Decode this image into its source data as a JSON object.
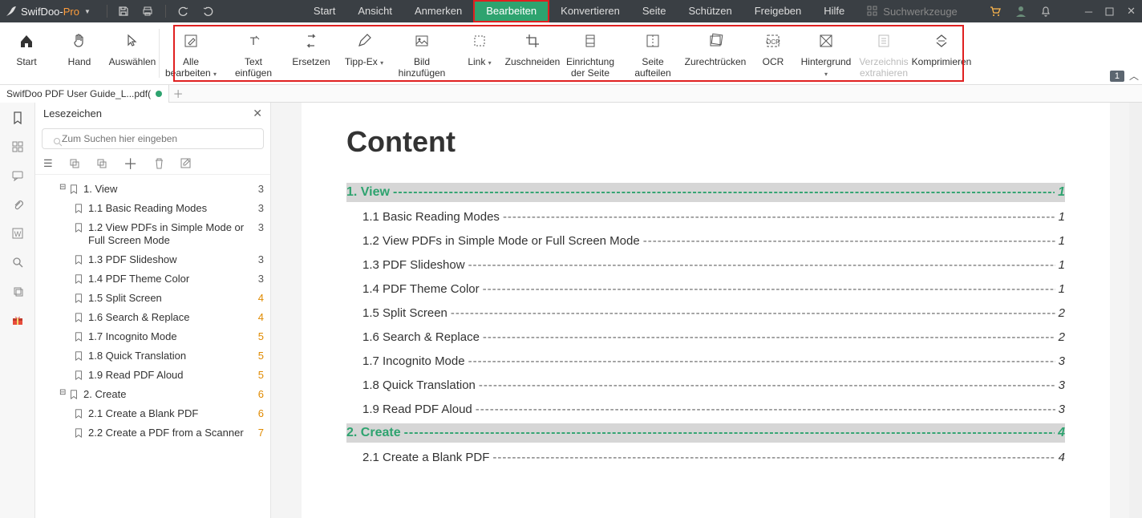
{
  "app": {
    "name1": "SwifDoo-",
    "name2": "Pro"
  },
  "menu": {
    "items": [
      "Start",
      "Ansicht",
      "Anmerken",
      "Bearbeiten",
      "Konvertieren",
      "Seite",
      "Schützen",
      "Freigeben",
      "Hilfe"
    ],
    "active_index": 3,
    "search_placeholder": "Suchwerkzeuge"
  },
  "ribbon": {
    "left": [
      {
        "label": "Start",
        "icon": "home"
      },
      {
        "label": "Hand",
        "icon": "hand"
      },
      {
        "label": "Auswählen",
        "icon": "pointer"
      }
    ],
    "tools": [
      {
        "label": "Alle bearbeiten",
        "icon": "edit-all",
        "drop": true
      },
      {
        "label": "Text einfügen",
        "icon": "text"
      },
      {
        "label": "Ersetzen",
        "icon": "replace"
      },
      {
        "label": "Tipp-Ex",
        "icon": "pen",
        "drop": true
      },
      {
        "label": "Bild hinzufügen",
        "icon": "image"
      },
      {
        "label": "Link",
        "icon": "link",
        "drop": true
      },
      {
        "label": "Zuschneiden",
        "icon": "crop"
      },
      {
        "label": "Einrichtung der Seite",
        "icon": "page-setup"
      },
      {
        "label": "Seite aufteilen",
        "icon": "split"
      },
      {
        "label": "Zurechtrücken",
        "icon": "deskew"
      },
      {
        "label": "OCR",
        "icon": "ocr"
      },
      {
        "label": "Hintergrund",
        "icon": "background",
        "drop": true
      },
      {
        "label": "Verzeichnis extrahieren",
        "icon": "toc",
        "disabled": true
      },
      {
        "label": "Komprimieren",
        "icon": "compress"
      }
    ],
    "page_flag": "1"
  },
  "doc_tab": "SwifDoo PDF User Guide_L...pdf(",
  "bookmarks": {
    "title": "Lesezeichen",
    "search_placeholder": "Zum Suchen hier eingeben",
    "tree": [
      {
        "level": 1,
        "toggle": "-",
        "label": "1. View",
        "page": "3"
      },
      {
        "level": 2,
        "label": "1.1 Basic Reading Modes",
        "page": "3"
      },
      {
        "level": 2,
        "label": "1.2 View PDFs in Simple Mode or Full Screen Mode",
        "page": "3"
      },
      {
        "level": 2,
        "label": "1.3 PDF Slideshow",
        "page": "3"
      },
      {
        "level": 2,
        "label": "1.4 PDF Theme Color",
        "page": "3"
      },
      {
        "level": 2,
        "label": "1.5 Split Screen",
        "page": "4",
        "orange": true
      },
      {
        "level": 2,
        "label": "1.6 Search & Replace",
        "page": "4",
        "orange": true
      },
      {
        "level": 2,
        "label": "1.7 Incognito Mode",
        "page": "5",
        "orange": true
      },
      {
        "level": 2,
        "label": "1.8 Quick Translation",
        "page": "5",
        "orange": true
      },
      {
        "level": 2,
        "label": "1.9 Read PDF Aloud",
        "page": "5",
        "orange": true
      },
      {
        "level": 1,
        "toggle": "-",
        "label": "2. Create",
        "page": "6",
        "orange": true
      },
      {
        "level": 2,
        "label": "2.1 Create a Blank PDF",
        "page": "6",
        "orange": true
      },
      {
        "level": 2,
        "label": "2.2 Create a PDF from a Scanner",
        "page": "7",
        "orange": true
      }
    ]
  },
  "document": {
    "title": "Content",
    "sections": [
      {
        "head": "1. View",
        "page": "1",
        "items": [
          {
            "label": "1.1 Basic Reading Modes",
            "page": "1"
          },
          {
            "label": "1.2 View PDFs in Simple Mode or Full Screen Mode",
            "page": "1"
          },
          {
            "label": "1.3 PDF Slideshow",
            "page": "1"
          },
          {
            "label": "1.4 PDF Theme Color",
            "page": "1"
          },
          {
            "label": "1.5 Split Screen",
            "page": "2"
          },
          {
            "label": "1.6 Search & Replace",
            "page": "2"
          },
          {
            "label": "1.7 Incognito Mode",
            "page": "3"
          },
          {
            "label": "1.8 Quick Translation",
            "page": "3"
          },
          {
            "label": "1.9 Read PDF Aloud",
            "page": "3"
          }
        ]
      },
      {
        "head": "2. Create",
        "page": "4",
        "items": [
          {
            "label": "2.1 Create a Blank PDF",
            "page": "4"
          }
        ]
      }
    ]
  }
}
